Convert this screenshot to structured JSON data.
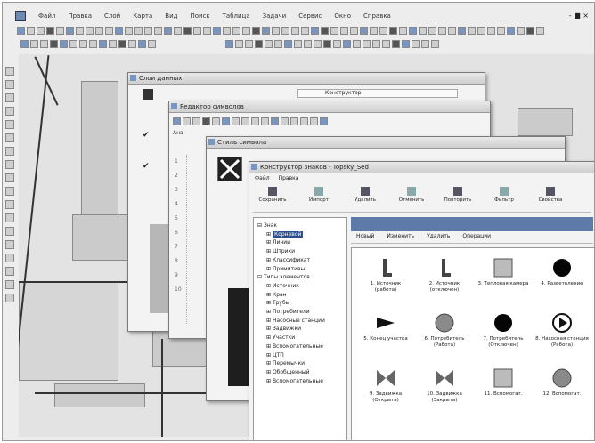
{
  "menubar": {
    "items": [
      "Файл",
      "Правка",
      "Слой",
      "Карта",
      "Вид",
      "Поиск",
      "Таблица",
      "Задачи",
      "Сервис",
      "Окно",
      "Справка"
    ]
  },
  "status": {
    "right": "- ■ ×"
  },
  "windows": {
    "layers": {
      "title": "Слои данных",
      "extra_label": "Конструктор"
    },
    "symbols": {
      "title": "Редактор символов",
      "tab_label": "Ана"
    },
    "style": {
      "title": "Стиль символа"
    },
    "library": {
      "title": "Конструктор знаков - Topsky_Sed",
      "menu": [
        "Файл",
        "Правка"
      ],
      "toolbar": [
        "Сохранить",
        "Импорт",
        "Удалить",
        "Отменить",
        "Повторить",
        "Фильтр",
        "Свойства"
      ],
      "subtoolbar": [
        "Новый",
        "Изменить",
        "Удалить",
        "Операции"
      ],
      "tree": [
        {
          "label": "Знак",
          "level": 0
        },
        {
          "label": "Корневой",
          "level": 1,
          "selected": true
        },
        {
          "label": "Линии",
          "level": 1
        },
        {
          "label": "Штрихи",
          "level": 1
        },
        {
          "label": "Классификат",
          "level": 1
        },
        {
          "label": "Примитивы",
          "level": 1
        },
        {
          "label": "Типы элементов",
          "level": 0
        },
        {
          "label": "Источник",
          "level": 1
        },
        {
          "label": "Кран",
          "level": 1
        },
        {
          "label": "Трубы",
          "level": 1
        },
        {
          "label": "Потребители",
          "level": 1
        },
        {
          "label": "Насосные станции",
          "level": 1
        },
        {
          "label": "Задвижки",
          "level": 1
        },
        {
          "label": "Участки",
          "level": 1
        },
        {
          "label": "Вспомогательные",
          "level": 1
        },
        {
          "label": "ЦТП",
          "level": 1
        },
        {
          "label": "Перемычки",
          "level": 1
        },
        {
          "label": "Обобщенный",
          "level": 1
        },
        {
          "label": "Вспомогательные",
          "level": 1
        }
      ],
      "symbols": [
        {
          "label": "1. Источник (работа)",
          "icon": "tower-icon"
        },
        {
          "label": "2. Источник (отключен)",
          "icon": "tower-icon"
        },
        {
          "label": "3. Тепловая камера",
          "icon": "square-icon"
        },
        {
          "label": "4. Разветвление",
          "icon": "black-circle-icon"
        },
        {
          "label": "5. Конец участка",
          "icon": "triangle-icon"
        },
        {
          "label": "6. Потребитель (Работа)",
          "icon": "grey-circle-icon"
        },
        {
          "label": "7. Потребитель (Отключен)",
          "icon": "black-circle-icon"
        },
        {
          "label": "8. Насосная станция (Работа)",
          "icon": "play-circle-icon"
        },
        {
          "label": "9. Задвижка (Открыта)",
          "icon": "bowtie-icon"
        },
        {
          "label": "10. Задвижка (Закрыта)",
          "icon": "bowtie-icon"
        },
        {
          "label": "11. Вспомогат.",
          "icon": "square-icon"
        },
        {
          "label": "12. Вспомогат.",
          "icon": "grey-circle-icon"
        }
      ]
    }
  }
}
